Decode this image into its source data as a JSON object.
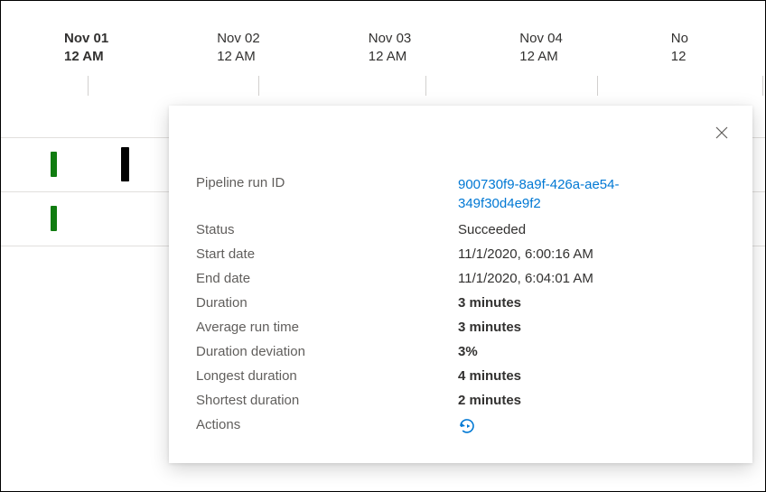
{
  "timeline": {
    "dates": [
      {
        "date": "Nov 01",
        "time": "12 AM",
        "active": true
      },
      {
        "date": "Nov 02",
        "time": "12 AM",
        "active": false
      },
      {
        "date": "Nov 03",
        "time": "12 AM",
        "active": false
      },
      {
        "date": "Nov 04",
        "time": "12 AM",
        "active": false
      },
      {
        "date": "No",
        "time": "12",
        "active": false
      }
    ]
  },
  "details": {
    "labels": {
      "pipeline_run_id": "Pipeline run ID",
      "status": "Status",
      "start_date": "Start date",
      "end_date": "End date",
      "duration": "Duration",
      "average_run_time": "Average run time",
      "duration_deviation": "Duration deviation",
      "longest_duration": "Longest duration",
      "shortest_duration": "Shortest duration",
      "actions": "Actions"
    },
    "values": {
      "pipeline_run_id": "900730f9-8a9f-426a-ae54-349f30d4e9f2",
      "status": "Succeeded",
      "start_date": "11/1/2020, 6:00:16 AM",
      "end_date": "11/1/2020, 6:04:01 AM",
      "duration": "3 minutes",
      "average_run_time": "3 minutes",
      "duration_deviation": "3%",
      "longest_duration": "4 minutes",
      "shortest_duration": "2 minutes"
    }
  }
}
